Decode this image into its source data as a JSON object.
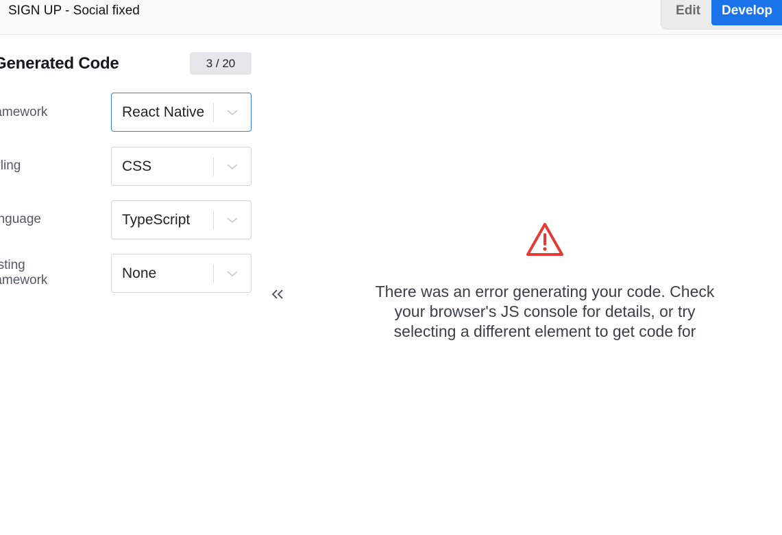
{
  "header": {
    "title": "SIGN UP - Social fixed",
    "mode_edit": "Edit",
    "mode_develop": "Develop"
  },
  "panel": {
    "title": "Generated Code",
    "count": "3 / 20",
    "stray": ")",
    "fields": [
      {
        "label": "ramework",
        "value": "React Native"
      },
      {
        "label": "tyling",
        "value": "CSS"
      },
      {
        "label": "anguage",
        "value": "TypeScript"
      },
      {
        "label": "esting\nramework",
        "value": "None"
      }
    ]
  },
  "error": {
    "message": "There was an error generating your code. Check your browser's JS console for details, or try selecting a different element to get code for"
  },
  "colors": {
    "accent": "#1a73e8",
    "error": "#e53935"
  },
  "icons": {
    "collapse": "double-chevron-left-icon",
    "warning": "warning-triangle-icon",
    "dropdown": "chevron-down-icon"
  }
}
